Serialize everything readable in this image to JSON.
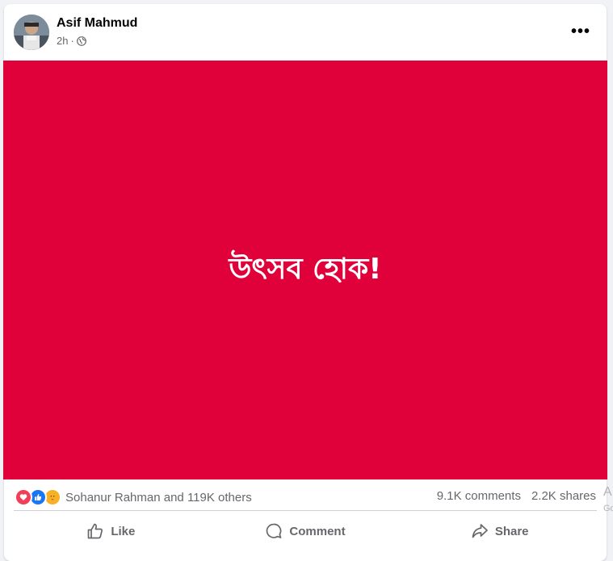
{
  "post": {
    "author": "Asif Mahmud",
    "time": "2h",
    "separator": "·",
    "privacy_icon": "globe-icon",
    "more_label": "•••",
    "image_text": "উৎসব হোক!",
    "image_bg": "#e0003a"
  },
  "stats": {
    "reaction_icons": [
      "love-icon",
      "like-icon",
      "care-icon"
    ],
    "reactions_text": "Sohanur Rahman and 119K others",
    "comments": "9.1K comments",
    "shares": "2.2K shares"
  },
  "actions": {
    "like": "Like",
    "comment": "Comment",
    "share": "Share"
  },
  "edge": {
    "text1": "A",
    "text2": "Go"
  },
  "colors": {
    "accent": "#1877f2",
    "secondary_text": "#65676b",
    "love": "#f33e58",
    "care": "#f7b125"
  }
}
